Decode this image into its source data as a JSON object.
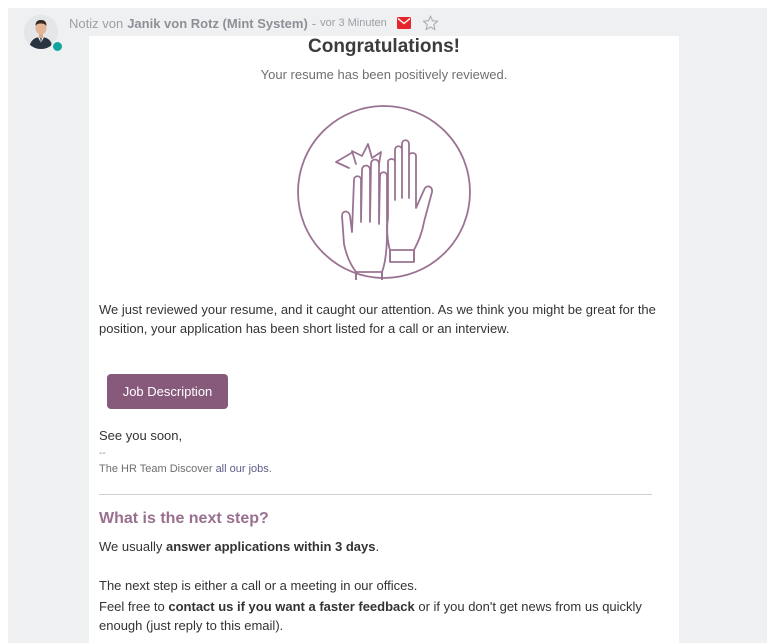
{
  "message": {
    "type_prefix": "Notiz von",
    "author": "Janik von Rotz (Mint System)",
    "separator": "-",
    "date": "vor 3 Minuten",
    "icons": {
      "envelope": "envelope-icon",
      "star": "star-icon"
    }
  },
  "email": {
    "title": "Congratulations!",
    "subtitle": "Your resume has been positively reviewed.",
    "body": "We just reviewed your resume, and it caught our attention. As we think you might be great for the position, your application has been short listed for a call or an interview.",
    "button_label": "Job Description",
    "closing": "See you soon,",
    "dash": "--",
    "signature_text": "The HR Team Discover",
    "signature_link": "all our jobs",
    "signature_end": ".",
    "next_step_heading": "What is the next step?",
    "line1_pre": "We usually ",
    "line1_bold": "answer applications within 3 days",
    "line1_end": ".",
    "line2": "The next step is either a call or a meeting in our offices.",
    "para2_pre": "Feel free to ",
    "para2_bold": "contact us if you want a faster feedback",
    "para2_end": " or if you don't get news from us quickly enough (just reply to this email)."
  },
  "colors": {
    "accent": "#875a7b",
    "heading": "#99708f",
    "envelope": "#e6242b",
    "presence": "#12a5a0"
  }
}
